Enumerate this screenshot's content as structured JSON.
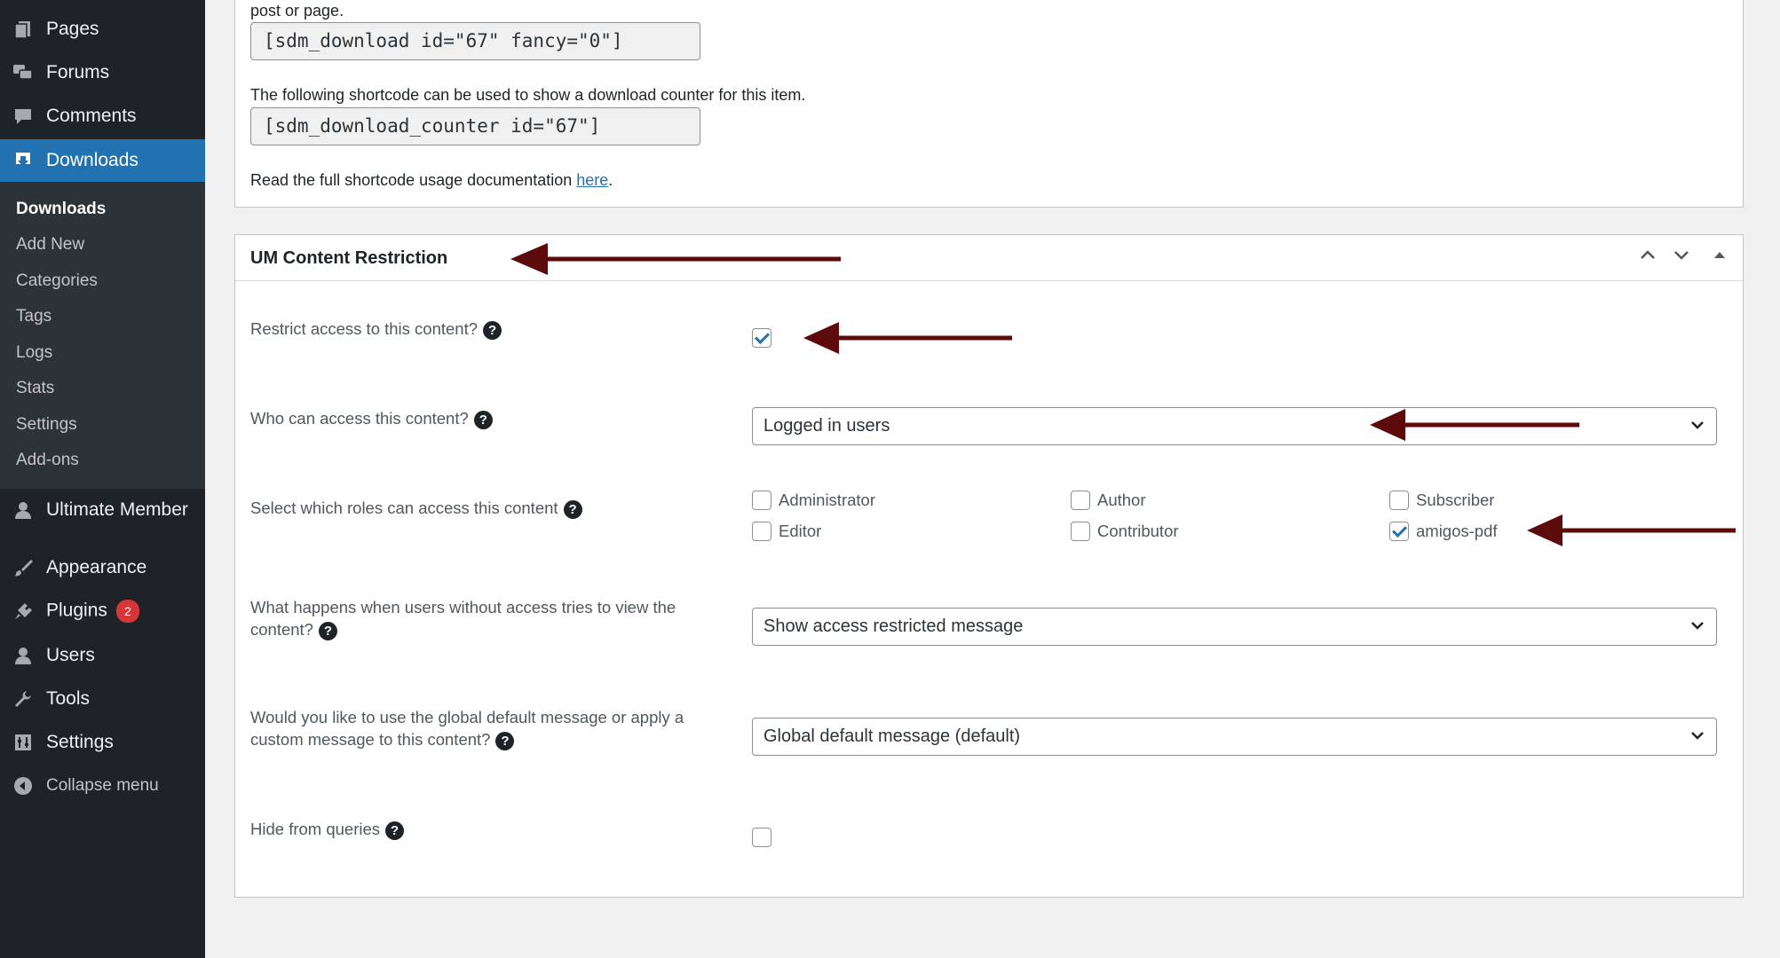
{
  "sidebar": {
    "menu": [
      {
        "label": "Pages",
        "icon": "pages-icon"
      },
      {
        "label": "Forums",
        "icon": "forums-icon"
      },
      {
        "label": "Comments",
        "icon": "comments-icon"
      },
      {
        "label": "Downloads",
        "icon": "downloads-icon"
      },
      {
        "label": "Ultimate Member",
        "icon": "user-icon"
      },
      {
        "label": "Appearance",
        "icon": "brush-icon"
      },
      {
        "label": "Plugins",
        "icon": "plugin-icon",
        "badge": "2"
      },
      {
        "label": "Users",
        "icon": "user-icon"
      },
      {
        "label": "Tools",
        "icon": "wrench-icon"
      },
      {
        "label": "Settings",
        "icon": "settings-icon"
      }
    ],
    "submenu": [
      "Downloads",
      "Add New",
      "Categories",
      "Tags",
      "Logs",
      "Stats",
      "Settings",
      "Add-ons"
    ],
    "collapse_label": "Collapse menu"
  },
  "shortcodes": {
    "intro_tail": "post or page.",
    "download_shortcode": "[sdm_download id=\"67\" fancy=\"0\"]",
    "counter_text": "The following shortcode can be used to show a download counter for this item.",
    "counter_shortcode": "[sdm_download_counter id=\"67\"]",
    "doc_text": "Read the full shortcode usage documentation ",
    "doc_link": "here",
    "doc_period": "."
  },
  "restriction": {
    "title": "UM Content Restriction",
    "restrict_label": "Restrict access to this content?",
    "restrict_checked": true,
    "who_label": "Who can access this content?",
    "who_value": "Logged in users",
    "roles_label": "Select which roles can access this content",
    "roles": [
      {
        "label": "Administrator",
        "checked": false
      },
      {
        "label": "Author",
        "checked": false
      },
      {
        "label": "Subscriber",
        "checked": false
      },
      {
        "label": "Editor",
        "checked": false
      },
      {
        "label": "Contributor",
        "checked": false
      },
      {
        "label": "amigos-pdf",
        "checked": true
      }
    ],
    "no_access_label": "What happens when users without access tries to view the content?",
    "no_access_value": "Show access restricted message",
    "message_label": "Would you like to use the global default message or apply a custom message to this content?",
    "message_value": "Global default message (default)",
    "hide_label": "Hide from queries",
    "hide_checked": false
  },
  "colors": {
    "sidebar_bg": "#1d2327",
    "accent": "#2271b1",
    "arrow": "#5c0a0a"
  }
}
